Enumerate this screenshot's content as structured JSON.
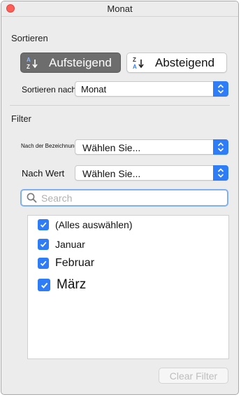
{
  "window": {
    "title": "Monat"
  },
  "sort": {
    "section_label": "Sortieren",
    "ascending_label": "Aufsteigend",
    "descending_label": "Absteigend",
    "selected": "ascending",
    "sort_by_label": "Sortieren nach:",
    "sort_by_value": "Monat"
  },
  "filter": {
    "section_label": "Filter",
    "by_label_label": "Nach der Bezeichnung:",
    "by_label_value": "Wählen Sie...",
    "by_value_label": "Nach Wert",
    "by_value_value": "Wählen Sie...",
    "search_placeholder": "Search",
    "items": [
      {
        "label": "(Alles auswählen)",
        "checked": true
      },
      {
        "label": "Januar",
        "checked": true
      },
      {
        "label": "Februar",
        "checked": true
      },
      {
        "label": "März",
        "checked": true
      }
    ],
    "clear_button_label": "Clear Filter"
  },
  "colors": {
    "accent": "#2e7cf6",
    "active_button": "#6d6d6d",
    "close_button": "#fc5f57"
  }
}
